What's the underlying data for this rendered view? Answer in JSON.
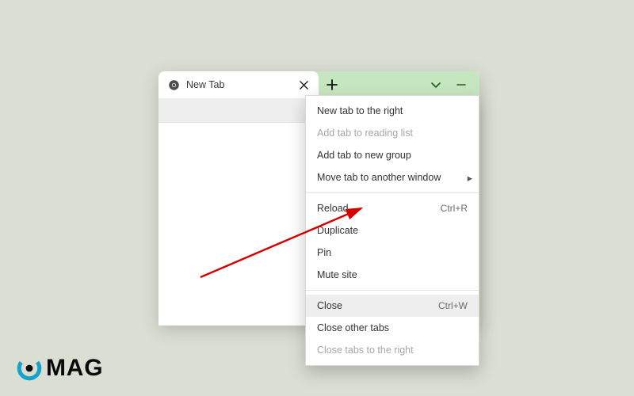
{
  "tab": {
    "title": "New Tab"
  },
  "menu": {
    "items": [
      {
        "label": "New tab to the right"
      },
      {
        "label": "Add tab to reading list",
        "disabled": true
      },
      {
        "label": "Add tab to new group"
      },
      {
        "label": "Move tab to another window",
        "submenu": true
      }
    ],
    "items2": [
      {
        "label": "Reload",
        "shortcut": "Ctrl+R"
      },
      {
        "label": "Duplicate"
      },
      {
        "label": "Pin"
      },
      {
        "label": "Mute site"
      }
    ],
    "items3": [
      {
        "label": "Close",
        "shortcut": "Ctrl+W",
        "hover": true
      },
      {
        "label": "Close other tabs"
      },
      {
        "label": "Close tabs to the right",
        "disabled": true
      }
    ]
  },
  "logo": {
    "text": "MAG"
  }
}
